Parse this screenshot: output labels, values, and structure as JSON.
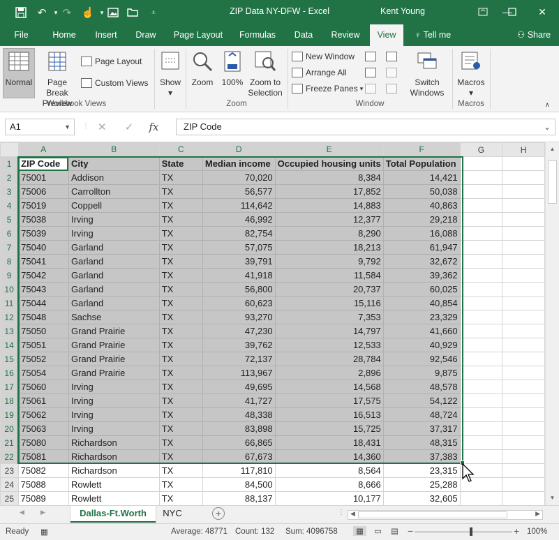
{
  "window": {
    "title": "ZIP Data NY-DFW  -  Excel",
    "user": "Kent Young",
    "minimize_icon": "minimize-icon",
    "restore_icon": "restore-icon",
    "close_icon": "close-icon"
  },
  "ribbon_tabs": [
    "File",
    "Home",
    "Insert",
    "Draw",
    "Page Layout",
    "Formulas",
    "Data",
    "Review",
    "View"
  ],
  "active_tab": "View",
  "tell_me": "Tell me",
  "share": "Share",
  "ribbon": {
    "workbook_views": {
      "normal": "Normal",
      "page_break_line1": "Page Break",
      "page_break_line2": "Preview",
      "page_layout": "Page Layout",
      "custom_views": "Custom Views",
      "group_label": "Workbook Views"
    },
    "show": {
      "label": "Show"
    },
    "zoom": {
      "zoom": "Zoom",
      "hundred": "100%",
      "zoom_sel_line1": "Zoom to",
      "zoom_sel_line2": "Selection",
      "group_label": "Zoom"
    },
    "window": {
      "new_window": "New Window",
      "arrange_all": "Arrange All",
      "freeze_panes": "Freeze Panes",
      "switch_line1": "Switch",
      "switch_line2": "Windows",
      "group_label": "Window"
    },
    "macros": {
      "macros": "Macros",
      "group_label": "Macros"
    }
  },
  "formula_bar": {
    "name_box": "A1",
    "fx": "fx",
    "content": "ZIP Code"
  },
  "columns": [
    "A",
    "B",
    "C",
    "D",
    "E",
    "F",
    "G",
    "H"
  ],
  "header_row": [
    "ZIP Code",
    "City",
    "State",
    "Median income",
    "Occupied housing units",
    "Total Population"
  ],
  "rows": [
    [
      "75001",
      "Addison",
      "TX",
      "70,020",
      "8,384",
      "14,421"
    ],
    [
      "75006",
      "Carrollton",
      "TX",
      "56,577",
      "17,852",
      "50,038"
    ],
    [
      "75019",
      "Coppell",
      "TX",
      "114,642",
      "14,883",
      "40,863"
    ],
    [
      "75038",
      "Irving",
      "TX",
      "46,992",
      "12,377",
      "29,218"
    ],
    [
      "75039",
      "Irving",
      "TX",
      "82,754",
      "8,290",
      "16,088"
    ],
    [
      "75040",
      "Garland",
      "TX",
      "57,075",
      "18,213",
      "61,947"
    ],
    [
      "75041",
      "Garland",
      "TX",
      "39,791",
      "9,792",
      "32,672"
    ],
    [
      "75042",
      "Garland",
      "TX",
      "41,918",
      "11,584",
      "39,362"
    ],
    [
      "75043",
      "Garland",
      "TX",
      "56,800",
      "20,737",
      "60,025"
    ],
    [
      "75044",
      "Garland",
      "TX",
      "60,623",
      "15,116",
      "40,854"
    ],
    [
      "75048",
      "Sachse",
      "TX",
      "93,270",
      "7,353",
      "23,329"
    ],
    [
      "75050",
      "Grand Prairie",
      "TX",
      "47,230",
      "14,797",
      "41,660"
    ],
    [
      "75051",
      "Grand Prairie",
      "TX",
      "39,762",
      "12,533",
      "40,929"
    ],
    [
      "75052",
      "Grand Prairie",
      "TX",
      "72,137",
      "28,784",
      "92,546"
    ],
    [
      "75054",
      "Grand Prairie",
      "TX",
      "113,967",
      "2,896",
      "9,875"
    ],
    [
      "75060",
      "Irving",
      "TX",
      "49,695",
      "14,568",
      "48,578"
    ],
    [
      "75061",
      "Irving",
      "TX",
      "41,727",
      "17,575",
      "54,122"
    ],
    [
      "75062",
      "Irving",
      "TX",
      "48,338",
      "16,513",
      "48,724"
    ],
    [
      "75063",
      "Irving",
      "TX",
      "83,898",
      "15,725",
      "37,317"
    ],
    [
      "75080",
      "Richardson",
      "TX",
      "66,865",
      "18,431",
      "48,315"
    ],
    [
      "75081",
      "Richardson",
      "TX",
      "67,673",
      "14,360",
      "37,383"
    ],
    [
      "75082",
      "Richardson",
      "TX",
      "117,810",
      "8,564",
      "23,315"
    ],
    [
      "75088",
      "Rowlett",
      "TX",
      "84,500",
      "8,666",
      "25,288"
    ],
    [
      "75089",
      "Rowlett",
      "TX",
      "88,137",
      "10,177",
      "32,605"
    ]
  ],
  "selected_last_row": 22,
  "sheets": [
    "Dallas-Ft.Worth",
    "NYC"
  ],
  "active_sheet": "Dallas-Ft.Worth",
  "status": {
    "ready": "Ready",
    "average": "Average: 48771",
    "count": "Count: 132",
    "sum": "Sum: 4096758",
    "zoom": "100%"
  },
  "colors": {
    "excel_green": "#217346",
    "selection_gray": "#c6c6c6"
  }
}
